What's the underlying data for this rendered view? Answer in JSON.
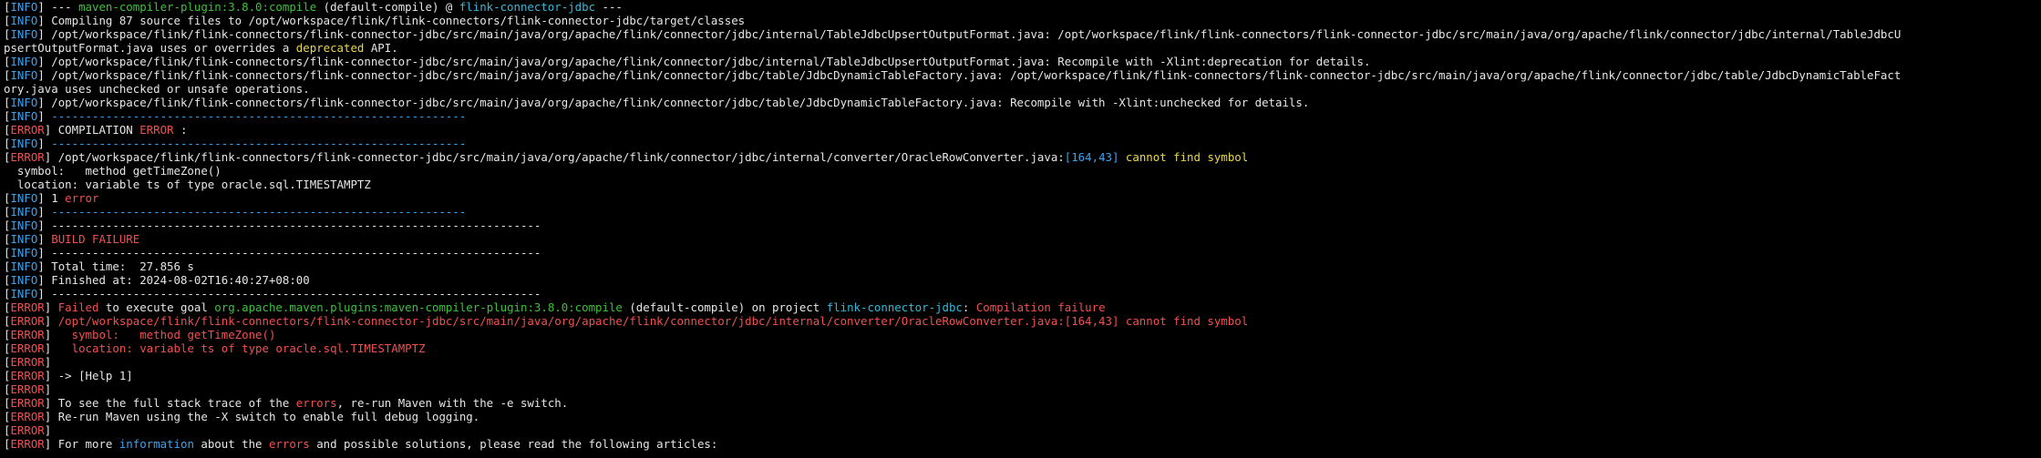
{
  "colors": {
    "background": "#000000",
    "default": "#e6e6e6",
    "info": "#3aa3f0",
    "error": "#f15050",
    "green": "#3cc23c",
    "cyan": "#35b9d8",
    "yellow": "#e8d84a"
  },
  "lines": [
    [
      [
        "[",
        "default"
      ],
      [
        "INFO",
        "info"
      ],
      [
        "] --- ",
        "default"
      ],
      [
        "maven-compiler-plugin:3.8.0:compile",
        "green"
      ],
      [
        " (default-compile) @ ",
        "default"
      ],
      [
        "flink-connector-jdbc",
        "cyan"
      ],
      [
        " ---",
        "default"
      ]
    ],
    [
      [
        "[",
        "default"
      ],
      [
        "INFO",
        "info"
      ],
      [
        "] Compiling 87 source files to /opt/workspace/flink/flink-connectors/flink-connector-jdbc/target/classes",
        "default"
      ]
    ],
    [
      [
        "[",
        "default"
      ],
      [
        "INFO",
        "info"
      ],
      [
        "] /opt/workspace/flink/flink-connectors/flink-connector-jdbc/src/main/java/org/apache/flink/connector/jdbc/internal/TableJdbcUpsertOutputFormat.java: /opt/workspace/flink/flink-connectors/flink-connector-jdbc/src/main/java/org/apache/flink/connector/jdbc/internal/TableJdbcU",
        "default"
      ]
    ],
    [
      [
        "psertOutputFormat.java uses or overrides a ",
        "default"
      ],
      [
        "deprecated",
        "yellow"
      ],
      [
        " API.",
        "default"
      ]
    ],
    [
      [
        "[",
        "default"
      ],
      [
        "INFO",
        "info"
      ],
      [
        "] /opt/workspace/flink/flink-connectors/flink-connector-jdbc/src/main/java/org/apache/flink/connector/jdbc/internal/TableJdbcUpsertOutputFormat.java: Recompile with -Xlint:deprecation for details.",
        "default"
      ]
    ],
    [
      [
        "[",
        "default"
      ],
      [
        "INFO",
        "info"
      ],
      [
        "] /opt/workspace/flink/flink-connectors/flink-connector-jdbc/src/main/java/org/apache/flink/connector/jdbc/table/JdbcDynamicTableFactory.java: /opt/workspace/flink/flink-connectors/flink-connector-jdbc/src/main/java/org/apache/flink/connector/jdbc/table/JdbcDynamicTableFact",
        "default"
      ]
    ],
    [
      [
        "ory.java uses unchecked or unsafe operations.",
        "default"
      ]
    ],
    [
      [
        "[",
        "default"
      ],
      [
        "INFO",
        "info"
      ],
      [
        "] /opt/workspace/flink/flink-connectors/flink-connector-jdbc/src/main/java/org/apache/flink/connector/jdbc/table/JdbcDynamicTableFactory.java: Recompile with -Xlint:unchecked for details.",
        "default"
      ]
    ],
    [
      [
        "[",
        "default"
      ],
      [
        "INFO",
        "info"
      ],
      [
        "] ",
        "default"
      ],
      [
        "-------------------------------------------------------------",
        "info"
      ]
    ],
    [
      [
        "[",
        "default"
      ],
      [
        "ERROR",
        "error"
      ],
      [
        "] COMPILATION ",
        "default"
      ],
      [
        "ERROR",
        "error"
      ],
      [
        " :",
        "default"
      ]
    ],
    [
      [
        "[",
        "default"
      ],
      [
        "INFO",
        "info"
      ],
      [
        "] ",
        "default"
      ],
      [
        "-------------------------------------------------------------",
        "info"
      ]
    ],
    [
      [
        "[",
        "default"
      ],
      [
        "ERROR",
        "error"
      ],
      [
        "] /opt/workspace/flink/flink-connectors/flink-connector-jdbc/src/main/java/org/apache/flink/connector/jdbc/internal/converter/OracleRowConverter.java:",
        "default"
      ],
      [
        "[164,43]",
        "info"
      ],
      [
        " ",
        "default"
      ],
      [
        "cannot find symbol",
        "yellow"
      ]
    ],
    [
      [
        "  symbol:   method getTimeZone()",
        "default"
      ]
    ],
    [
      [
        "  location: variable ts of type oracle.sql.TIMESTAMPTZ",
        "default"
      ]
    ],
    [
      [
        "[",
        "default"
      ],
      [
        "INFO",
        "info"
      ],
      [
        "] 1 ",
        "default"
      ],
      [
        "error",
        "error"
      ]
    ],
    [
      [
        "[",
        "default"
      ],
      [
        "INFO",
        "info"
      ],
      [
        "] ",
        "default"
      ],
      [
        "-------------------------------------------------------------",
        "info"
      ]
    ],
    [
      [
        "[",
        "default"
      ],
      [
        "INFO",
        "info"
      ],
      [
        "] ------------------------------------------------------------------------",
        "default"
      ]
    ],
    [
      [
        "[",
        "default"
      ],
      [
        "INFO",
        "info"
      ],
      [
        "] ",
        "default"
      ],
      [
        "BUILD FAILURE",
        "error"
      ]
    ],
    [
      [
        "[",
        "default"
      ],
      [
        "INFO",
        "info"
      ],
      [
        "] ------------------------------------------------------------------------",
        "default"
      ]
    ],
    [
      [
        "[",
        "default"
      ],
      [
        "INFO",
        "info"
      ],
      [
        "] Total time:  27.856 s",
        "default"
      ]
    ],
    [
      [
        "[",
        "default"
      ],
      [
        "INFO",
        "info"
      ],
      [
        "] Finished at: 2024-08-02T16:40:27+08:00",
        "default"
      ]
    ],
    [
      [
        "[",
        "default"
      ],
      [
        "INFO",
        "info"
      ],
      [
        "] ------------------------------------------------------------------------",
        "default"
      ]
    ],
    [
      [
        "[",
        "default"
      ],
      [
        "ERROR",
        "error"
      ],
      [
        "] ",
        "default"
      ],
      [
        "Failed",
        "error"
      ],
      [
        " to execute goal ",
        "default"
      ],
      [
        "org.apache.maven.plugins:maven-compiler-plugin:3.8.0:compile",
        "green"
      ],
      [
        " (default-compile) on project ",
        "default"
      ],
      [
        "flink-connector-jdbc",
        "cyan"
      ],
      [
        ": ",
        "default"
      ],
      [
        "Compilation failure",
        "error"
      ]
    ],
    [
      [
        "[",
        "default"
      ],
      [
        "ERROR",
        "error"
      ],
      [
        "] ",
        "default"
      ],
      [
        "/opt/workspace/flink/flink-connectors/flink-connector-jdbc/src/main/java/org/apache/flink/connector/jdbc/internal/converter/OracleRowConverter.java:[164,43] cannot find symbol",
        "error"
      ]
    ],
    [
      [
        "[",
        "default"
      ],
      [
        "ERROR",
        "error"
      ],
      [
        "]   ",
        "default"
      ],
      [
        "symbol:   method getTimeZone()",
        "error"
      ]
    ],
    [
      [
        "[",
        "default"
      ],
      [
        "ERROR",
        "error"
      ],
      [
        "]   ",
        "default"
      ],
      [
        "location: variable ts of type oracle.sql.TIMESTAMPTZ",
        "error"
      ]
    ],
    [
      [
        "[",
        "default"
      ],
      [
        "ERROR",
        "error"
      ],
      [
        "]",
        "default"
      ]
    ],
    [
      [
        "[",
        "default"
      ],
      [
        "ERROR",
        "error"
      ],
      [
        "] -> [Help 1]",
        "default"
      ]
    ],
    [
      [
        "[",
        "default"
      ],
      [
        "ERROR",
        "error"
      ],
      [
        "]",
        "default"
      ]
    ],
    [
      [
        "[",
        "default"
      ],
      [
        "ERROR",
        "error"
      ],
      [
        "] To see the full stack trace of the ",
        "default"
      ],
      [
        "errors",
        "error"
      ],
      [
        ", re-run Maven with the -e switch.",
        "default"
      ]
    ],
    [
      [
        "[",
        "default"
      ],
      [
        "ERROR",
        "error"
      ],
      [
        "] Re-run Maven using the -X switch to enable full debug logging.",
        "default"
      ]
    ],
    [
      [
        "[",
        "default"
      ],
      [
        "ERROR",
        "error"
      ],
      [
        "]",
        "default"
      ]
    ],
    [
      [
        "[",
        "default"
      ],
      [
        "ERROR",
        "error"
      ],
      [
        "] For more ",
        "default"
      ],
      [
        "information",
        "info"
      ],
      [
        " about the ",
        "default"
      ],
      [
        "errors",
        "error"
      ],
      [
        " and possible solutions, please read the following articles:",
        "default"
      ]
    ]
  ]
}
